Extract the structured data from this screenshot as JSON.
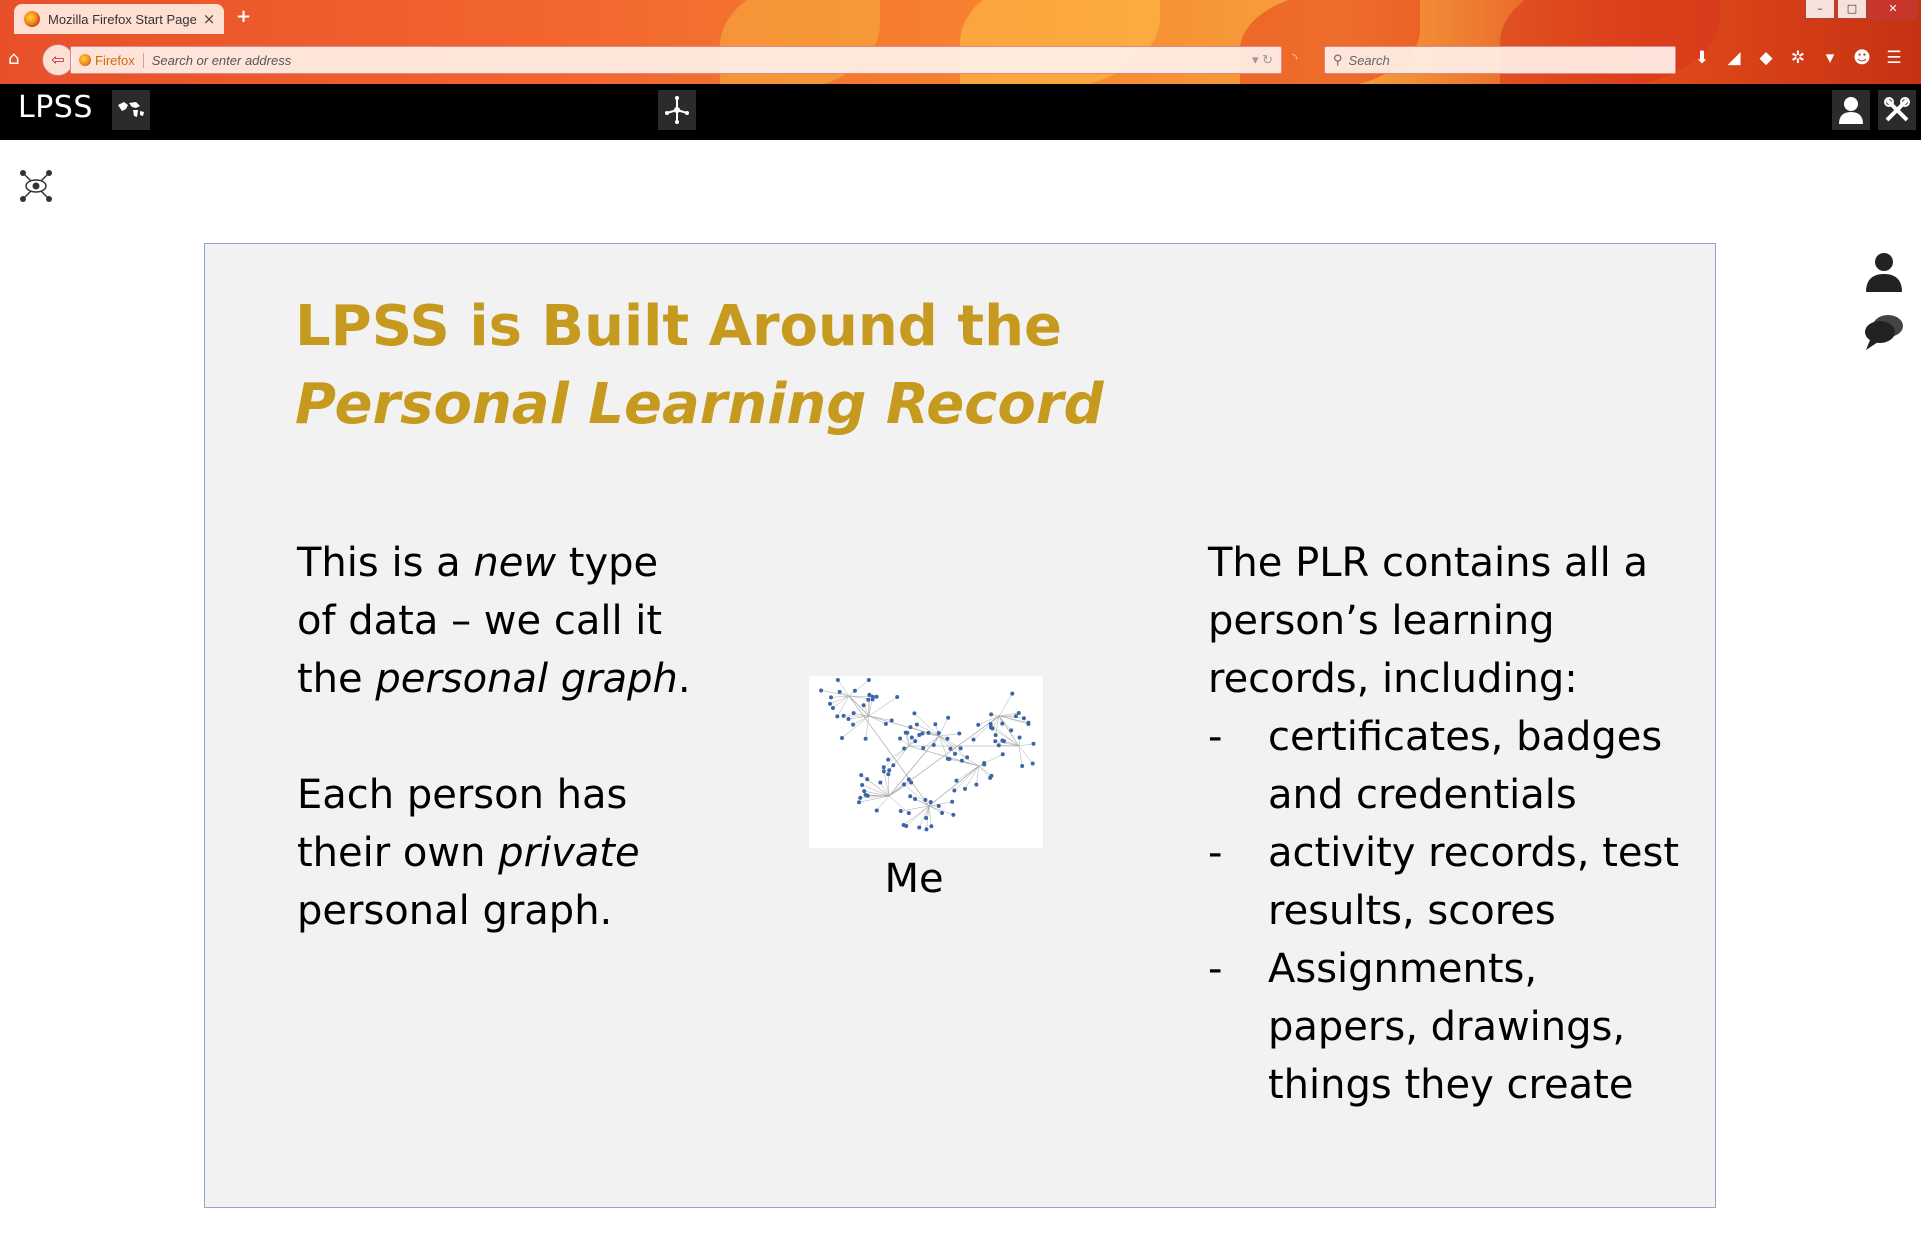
{
  "browser": {
    "tab_title": "Mozilla Firefox Start Page",
    "tab_close": "×",
    "new_tab": "+",
    "identity_label": "Firefox",
    "url_placeholder": "Search or enter address",
    "search_placeholder": "Search",
    "window_controls": {
      "minimize": "–",
      "maximize": "□",
      "close": "✕"
    }
  },
  "app": {
    "brand": "LPSS",
    "header_icons": [
      "world-map-icon",
      "network-icon",
      "user-icon",
      "tools-icon"
    ],
    "side_icons": [
      "user-icon",
      "chat-icon"
    ],
    "page_icon": "graph-eye-icon"
  },
  "slide": {
    "title_line1": "LPSS is Built Around the",
    "title_line2": "Personal Learning Record",
    "left": {
      "p1": {
        "a": "This is a ",
        "b": "new",
        "c": " type of data – we call it the ",
        "d": "personal graph",
        "e": "."
      },
      "p2": {
        "a": "Each person has their own ",
        "b": "private",
        "c": " personal graph."
      }
    },
    "graph_caption": "Me",
    "right": {
      "intro": "The PLR contains all a person’s learning records, including:",
      "bullets": [
        "certificates, badges and credentials",
        "activity records, test results, scores",
        "Assignments, papers, drawings, things they create"
      ],
      "bullet_marker": "-"
    }
  },
  "colors": {
    "title_gold": "#c59a1e",
    "slide_bg": "#f2f2f2",
    "slide_border": "#8fa8c8",
    "header_bg": "#000000",
    "graph_node": "#3b66a8"
  }
}
